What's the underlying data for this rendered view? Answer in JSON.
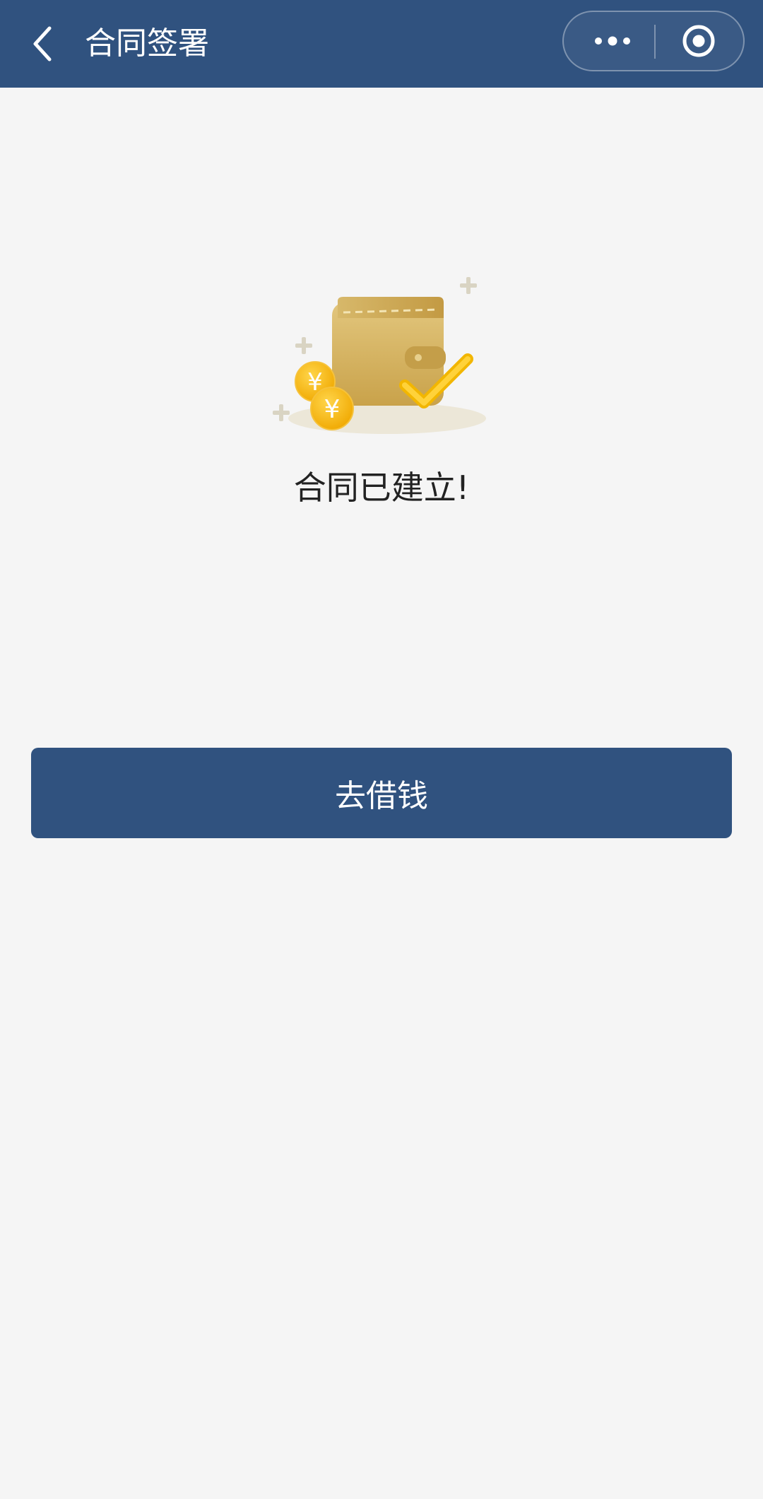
{
  "nav": {
    "title": "合同签署",
    "back_icon": "chevron-left-icon",
    "more_icon": "more-dots-icon",
    "close_icon": "target-icon",
    "background_color": "#30527f"
  },
  "result": {
    "illustration": "wallet-coins-check-illustration",
    "message": "合同已建立!"
  },
  "actions": {
    "primary_label": "去借钱",
    "primary_color": "#30527f"
  },
  "page": {
    "background_color": "#f5f5f5"
  }
}
